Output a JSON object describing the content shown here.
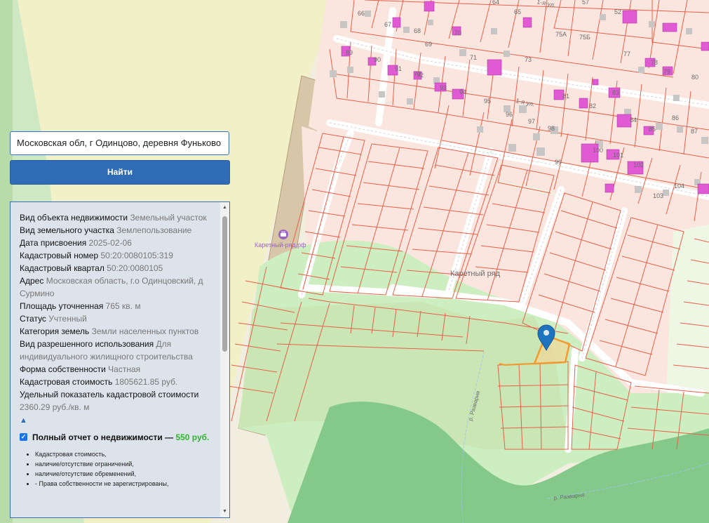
{
  "search": {
    "value": "Московская обл, г Одинцово, деревня Фуньково",
    "button_label": "Найти"
  },
  "property": {
    "rows": [
      {
        "label": "Вид объекта недвижимости",
        "value": "Земельный участок"
      },
      {
        "label": "Вид земельного участка",
        "value": "Землепользование"
      },
      {
        "label": "Дата присвоения",
        "value": "2025-02-06"
      },
      {
        "label": "Кадастровый номер",
        "value": "50:20:0080105:319"
      },
      {
        "label": "Кадастровый квартал",
        "value": "50:20:0080105"
      },
      {
        "label": "Адрес",
        "value": "Московская область, г.о Одинцовский, д Сурмино"
      },
      {
        "label": "Площадь уточненная",
        "value": "765 кв. м"
      },
      {
        "label": "Статус",
        "value": "Учтенный"
      },
      {
        "label": "Категория земель",
        "value": "Земли населенных пунктов"
      },
      {
        "label": "Вид разрешенного использования",
        "value": "Для индивидуального жилищного строительства"
      },
      {
        "label": "Форма собственности",
        "value": "Частная"
      },
      {
        "label": "Кадастровая стоимость",
        "value": "1805621.85 руб."
      },
      {
        "label": "Удельный показатель кадастровой стоимости",
        "value": "2360.29 руб./кв. м"
      }
    ],
    "collapse_symbol": "▲"
  },
  "report": {
    "checked": true,
    "title": "Полный отчет о недвижимости —",
    "price": "550 руб.",
    "items": [
      "Кадастровая стоимость,",
      "наличие/отсутствие ограничений,",
      "наличие/отсутствие обременений,",
      "- Права собственности не зарегистрированы,"
    ]
  },
  "map": {
    "place_labels": {
      "poi": "Каретный-ряд.рф",
      "area": "Каретный ряд",
      "street_1": "1-я ул.",
      "river_1": "р. Разварня",
      "river_2": "р. Разварня"
    },
    "lot_numbers": [
      "66",
      "67",
      "68",
      "69",
      "70",
      "71",
      "72",
      "73",
      "75А",
      "75Б",
      "77",
      "78",
      "79",
      "80",
      "81",
      "82",
      "83",
      "84",
      "85",
      "86",
      "87",
      "89",
      "90",
      "91",
      "92",
      "93",
      "94",
      "95",
      "96",
      "97",
      "98",
      "99",
      "100",
      "101",
      "102",
      "103",
      "104",
      "65",
      "64",
      "57",
      "52"
    ],
    "colors": {
      "parcel_border": "#e8604a",
      "parcel_fill": "#fbe3dc",
      "building": "#e05ad4",
      "forest": "#88cc88",
      "meadow": "#cdeec0",
      "selected_parcel": "#f39a2f",
      "marker": "#1e73be"
    },
    "icons": [
      "map-pin-icon",
      "briefcase-icon"
    ]
  }
}
